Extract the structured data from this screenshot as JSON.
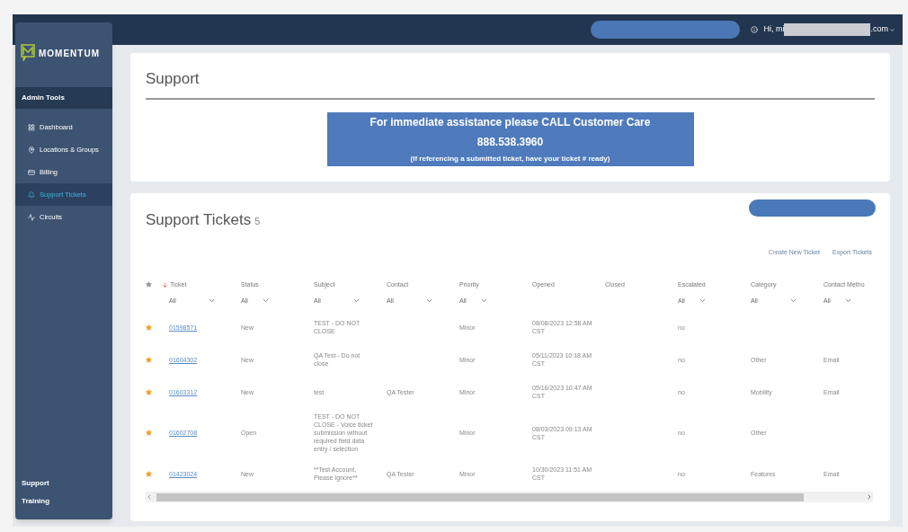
{
  "header": {
    "greeting": "Hi, mi",
    "email_suffix": ".com"
  },
  "sidebar": {
    "logo": "MOMENTUM",
    "section": "Admin Tools",
    "items": [
      {
        "label": "Dashboard",
        "selected": false
      },
      {
        "label": "Locations & Groups",
        "selected": false
      },
      {
        "label": "Billing",
        "selected": false
      },
      {
        "label": "Support Tickets",
        "selected": true
      },
      {
        "label": "Circuits",
        "selected": false
      }
    ],
    "footer_items": [
      "Support",
      "Training"
    ]
  },
  "support": {
    "title": "Support",
    "callout": [
      "For immediate assistance please CALL Customer Care",
      "888.538.3960",
      "(If referencing a submitted ticket, have your ticket # ready)"
    ]
  },
  "tickets": {
    "title": "Support Tickets",
    "count": "5",
    "actions": [
      "Create New Ticket",
      "Export Tickets"
    ],
    "columns": [
      {
        "label": "Ticket",
        "filter": "All",
        "sorted": true
      },
      {
        "label": "Status",
        "filter": "All",
        "sorted": false
      },
      {
        "label": "Subject",
        "filter": "All",
        "sorted": false
      },
      {
        "label": "Contact",
        "filter": "All",
        "sorted": false
      },
      {
        "label": "Priority",
        "filter": "All",
        "sorted": false
      },
      {
        "label": "Opened",
        "sorted": false
      },
      {
        "label": "Closed",
        "sorted": false
      },
      {
        "label": "Escalated",
        "filter": "All",
        "sorted": false
      },
      {
        "label": "Category",
        "filter": "All",
        "sorted": false
      },
      {
        "label": "Contact Metho",
        "filter": "All",
        "sorted": false
      }
    ],
    "rows": [
      {
        "cells": [
          "01598571",
          "New",
          "TEST - DO NOT CLOSE",
          null,
          "Minor",
          "08/08/2023 12:58 AM CST",
          null,
          "no",
          null,
          null
        ]
      },
      {
        "cells": [
          "01604302",
          "New",
          "QA Test - Do not close",
          null,
          "Minor",
          "05/11/2023 10:18 AM CST",
          null,
          "no",
          "Other",
          "Email"
        ]
      },
      {
        "cells": [
          "01603312",
          "New",
          "test",
          "QA Tester",
          "Minor",
          "05/16/2023 10:47 AM CST",
          null,
          "no",
          "Mobility",
          "Email"
        ]
      },
      {
        "cells": [
          "01602708",
          "Open",
          "TEST - DO NOT CLOSE - Voice ticket submission without required field data entry / selection",
          null,
          "Minor",
          "08/03/2023 09:13 AM CST",
          null,
          "no",
          "Other",
          null
        ]
      },
      {
        "cells": [
          "01423024",
          "New",
          "**Test Account, Please Ignore**",
          "QA Tester",
          "Minor",
          "10/30/2023 11:51 AM CST",
          null,
          "no",
          "Features",
          "Email"
        ]
      }
    ]
  }
}
